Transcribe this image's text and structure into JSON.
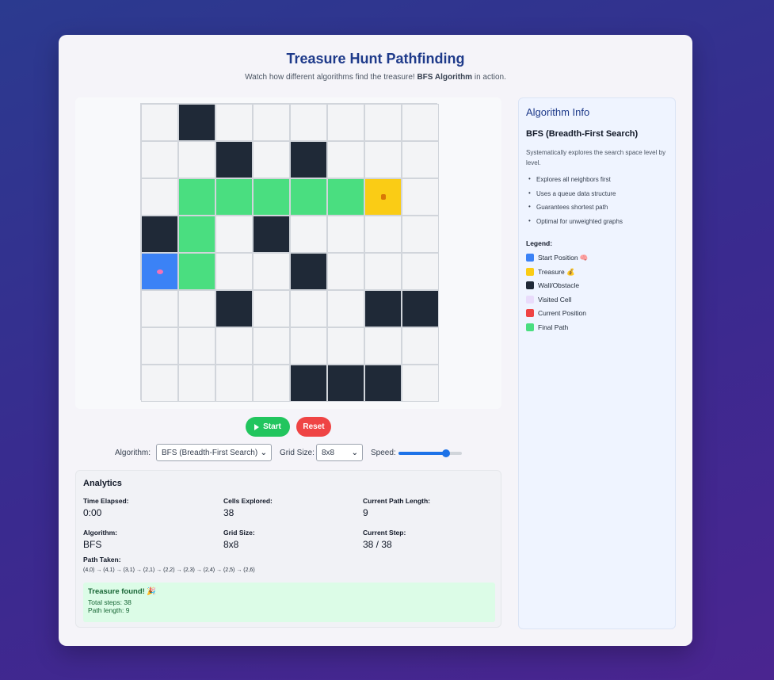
{
  "header": {
    "title": "Treasure Hunt Pathfinding",
    "subtitle_pre": "Watch how different algorithms find the treasure!",
    "subtitle_algo": "BFS Algorithm",
    "subtitle_post": "in action."
  },
  "grid": {
    "rows": [
      [
        ".",
        "W",
        ".",
        ".",
        ".",
        ".",
        ".",
        "."
      ],
      [
        ".",
        ".",
        "W",
        ".",
        "W",
        ".",
        ".",
        "."
      ],
      [
        ".",
        "P",
        "P",
        "P",
        "P",
        "P",
        "T",
        "."
      ],
      [
        "W",
        "P",
        ".",
        "W",
        ".",
        ".",
        ".",
        "."
      ],
      [
        "S",
        "P",
        ".",
        ".",
        "W",
        ".",
        ".",
        "."
      ],
      [
        ".",
        ".",
        "W",
        ".",
        ".",
        ".",
        "W",
        "W"
      ],
      [
        ".",
        ".",
        ".",
        ".",
        ".",
        ".",
        ".",
        "."
      ],
      [
        ".",
        ".",
        ".",
        ".",
        "W",
        "W",
        "W",
        "."
      ]
    ],
    "start_icon": "brain-emoji-icon",
    "treasure_icon": "money-bag-emoji-icon"
  },
  "controls": {
    "start_label": "Start",
    "reset_label": "Reset"
  },
  "settings": {
    "algorithm_label": "Algorithm:",
    "algorithm_value": "BFS (Breadth-First Search)",
    "grid_size_label": "Grid Size:",
    "grid_size_value": "8x8",
    "speed_label": "Speed:",
    "speed_fraction": 0.75
  },
  "analytics": {
    "title": "Analytics",
    "time_elapsed_label": "Time Elapsed:",
    "time_elapsed_value": "0:00",
    "cells_explored_label": "Cells Explored:",
    "cells_explored_value": "38",
    "current_path_length_label": "Current Path Length:",
    "current_path_length_value": "9",
    "algorithm_label": "Algorithm:",
    "algorithm_value": "BFS",
    "grid_size_label": "Grid Size:",
    "grid_size_value": "8x8",
    "current_step_label": "Current Step:",
    "current_step_value": "38 / 38",
    "path_taken_label": "Path Taken:",
    "path_taken_value": "(4,0) → (4,1) → (3,1) → (2,1) → (2,2) → (2,3) → (2,4) → (2,5) → (2,6)",
    "found_title": "Treasure found! 🎉",
    "found_steps": "Total steps: 38",
    "found_length": "Path length: 9"
  },
  "info": {
    "title": "Algorithm Info",
    "algo_name": "BFS (Breadth-First Search)",
    "description": "Systematically explores the search space level by level.",
    "bullets": [
      "Explores all neighbors first",
      "Uses a queue data structure",
      "Guarantees shortest path",
      "Optimal for unweighted graphs"
    ],
    "legend_title": "Legend:",
    "legend": [
      {
        "label": "Start Position 🧠",
        "color": "#3b82f6"
      },
      {
        "label": "Treasure 💰",
        "color": "#facc15"
      },
      {
        "label": "Wall/Obstacle",
        "color": "#1f2937"
      },
      {
        "label": "Visited Cell",
        "color": "#e9dcfb"
      },
      {
        "label": "Current Position",
        "color": "#ef4444"
      },
      {
        "label": "Final Path",
        "color": "#4ade80"
      }
    ]
  }
}
